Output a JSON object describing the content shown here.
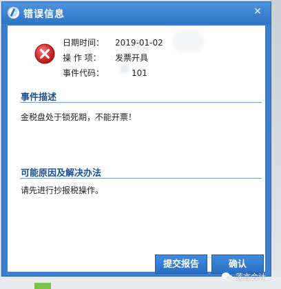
{
  "dialog": {
    "title": "错误信息",
    "close_label": "✕"
  },
  "info": {
    "date_label": "日期时间：",
    "date_value": "2019-01-02",
    "operation_label": "操 作 项：",
    "operation_value": "发票开具",
    "code_label": "事件代码：",
    "code_value": "101"
  },
  "description": {
    "heading": "事件描述",
    "text": "金税盘处于锁死期，不能开票！"
  },
  "solution": {
    "heading": "可能原因及解决办法",
    "text": "请先进行抄报税操作。"
  },
  "buttons": {
    "report": "提交报告",
    "confirm": "确认"
  },
  "watermark": {
    "text": "莲言会计"
  },
  "colors": {
    "title_bar": "#2f74c6",
    "button": "#2a6fc4",
    "error_icon": "#d42a2a",
    "section_title": "#1e4f8f"
  }
}
